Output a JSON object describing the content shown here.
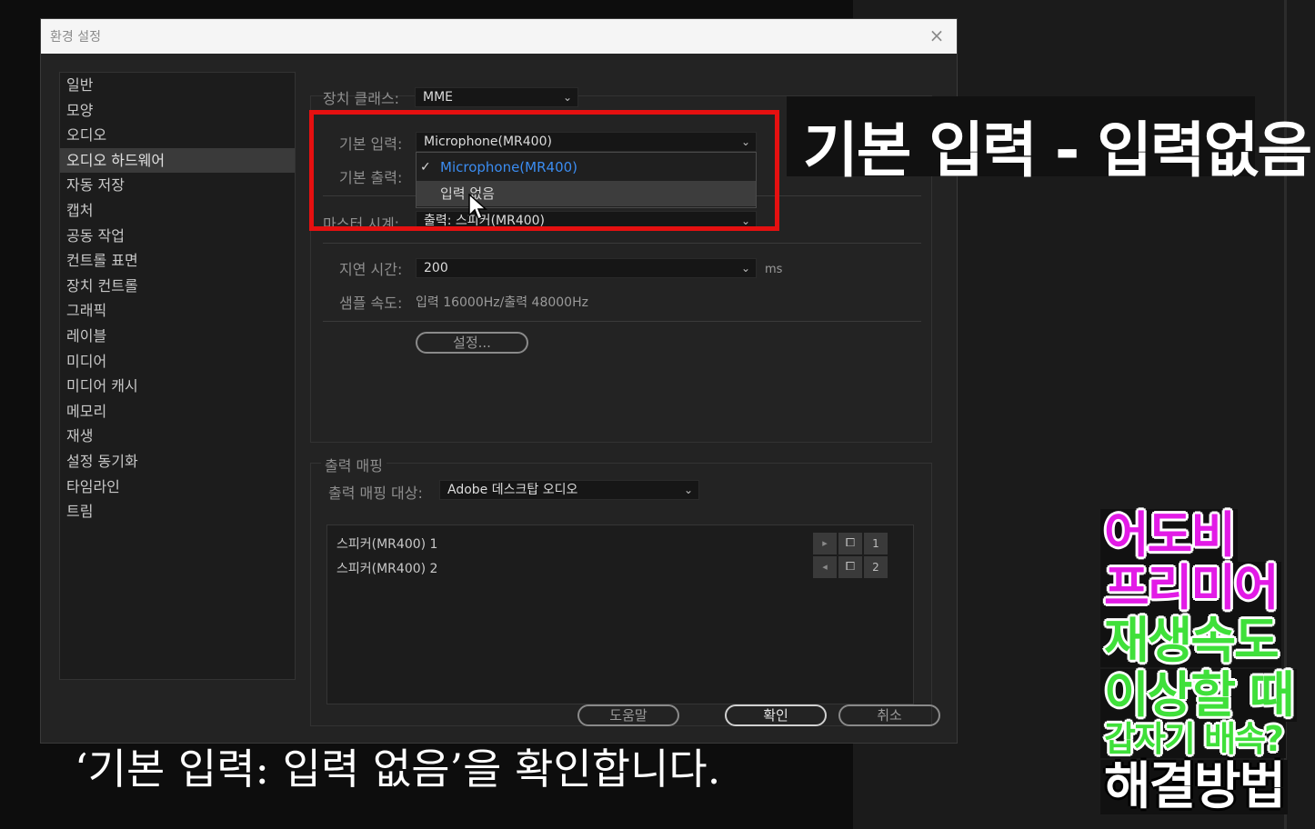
{
  "dialog": {
    "title": "환경 설정",
    "close_glyph": "×"
  },
  "sidebar": {
    "items": [
      {
        "label": "일반"
      },
      {
        "label": "모양"
      },
      {
        "label": "오디오"
      },
      {
        "label": "오디오 하드웨어",
        "selected": true
      },
      {
        "label": "자동 저장"
      },
      {
        "label": "캡처"
      },
      {
        "label": "공동 작업"
      },
      {
        "label": "컨트롤 표면"
      },
      {
        "label": "장치 컨트롤"
      },
      {
        "label": "그래픽"
      },
      {
        "label": "레이블"
      },
      {
        "label": "미디어"
      },
      {
        "label": "미디어 캐시"
      },
      {
        "label": "메모리"
      },
      {
        "label": "재생"
      },
      {
        "label": "설정 동기화"
      },
      {
        "label": "타임라인"
      },
      {
        "label": "트림"
      }
    ]
  },
  "hardware": {
    "device_class_label": "장치 클래스:",
    "device_class_value": "MME",
    "default_input_label": "기본 입력:",
    "default_input_value": "Microphone(MR400)",
    "default_output_label": "기본 출력:",
    "master_clock_label": "마스터 시계:",
    "master_clock_value": "출력: 스피커(MR400)",
    "latency_label": "지연 시간:",
    "latency_value": "200",
    "latency_unit": "ms",
    "sample_rate_label": "샘플 속도:",
    "sample_rate_value": "입력 16000Hz/출력 48000Hz",
    "settings_button": "설정..."
  },
  "input_dropdown": {
    "options": [
      {
        "label": "Microphone(MR400)",
        "checked": true
      },
      {
        "label": "입력 없음",
        "hovered": true
      }
    ]
  },
  "output_mapping": {
    "group_label": "출력 매핑",
    "target_label": "출력 매핑 대상:",
    "target_value": "Adobe 데스크탑 오디오",
    "channels": [
      {
        "label": "스피커(MR400) 1",
        "number": "1"
      },
      {
        "label": "스피커(MR400) 2",
        "number": "2"
      }
    ]
  },
  "buttons": {
    "help": "도움말",
    "ok": "확인",
    "cancel": "취소"
  },
  "overlay": {
    "callout": "기본 입력 - 입력없음",
    "caption": "‘기본 입력: 입력 없음’을 확인합니다.",
    "title_lines": [
      {
        "text": "어도비",
        "color": "#e21be6"
      },
      {
        "text": "프리미어",
        "color": "#e21be6"
      },
      {
        "text": "재생속도",
        "color": "#3fe03a"
      },
      {
        "text": "이상할 때",
        "color": "#3fe03a"
      },
      {
        "text": "갑자기 배속?",
        "color": "#3fe03a"
      },
      {
        "text": "해결방법",
        "color": "#ffffff"
      }
    ],
    "highlight_color": "#e51010"
  }
}
